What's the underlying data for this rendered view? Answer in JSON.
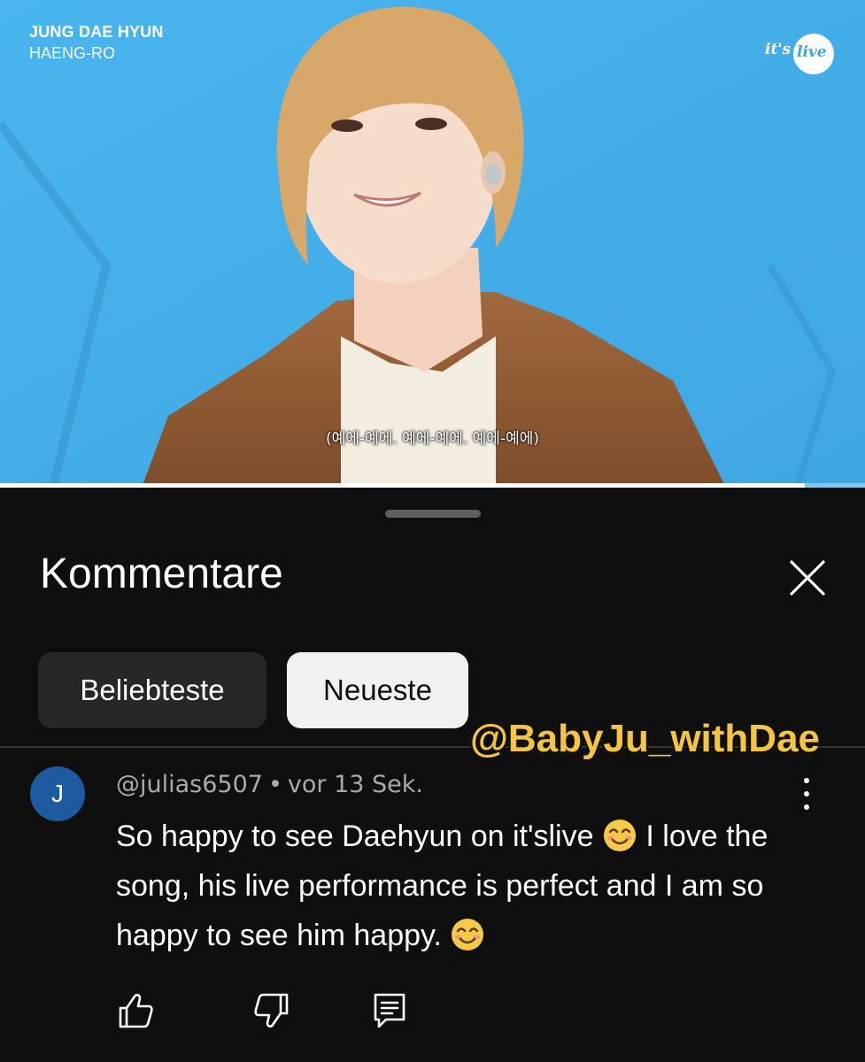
{
  "video": {
    "artist": "JUNG DAE HYUN",
    "song": "HAENG-RO",
    "brand": {
      "text_left": "it's",
      "text_right": "live"
    },
    "subtitle": "(예에-예에. 예에-예에. 예에-예에)",
    "progress": 0.93,
    "colors": {
      "background": "#41aee8"
    }
  },
  "sheet": {
    "title": "Kommentare",
    "chips": [
      {
        "label": "Beliebteste",
        "selected": false
      },
      {
        "label": "Neueste",
        "selected": true
      }
    ],
    "watermark": "@BabyJu_withDae"
  },
  "comment": {
    "avatar_letter": "J",
    "author": "@julias6507",
    "separator": "•",
    "time": "vor 13 Sek.",
    "text_part1": "So happy to see Daehyun on it'slive ",
    "text_part2": " I love the song, his live performance is perfect and I am so happy to see him happy. ",
    "emoji": "smiling-face-with-smiling-eyes",
    "actions": [
      "like-icon",
      "dislike-icon",
      "reply-icon"
    ]
  },
  "colors": {
    "sheet_bg": "#0f0f0f",
    "chip_bg": "#272727",
    "chip_selected_bg": "#f1f1f1",
    "avatar_bg": "#1e5aa0",
    "watermark": "#f6c445"
  }
}
